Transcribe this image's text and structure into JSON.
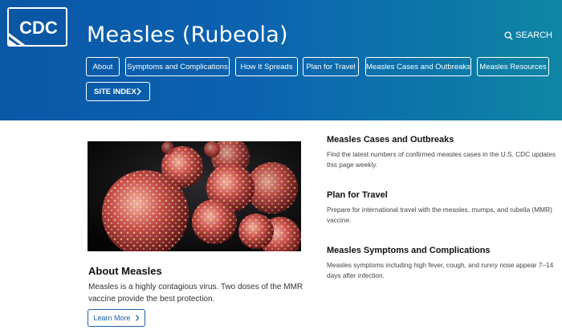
{
  "header": {
    "logo_text": "CDC",
    "title": "Measles (Rubeola)",
    "search_label": "SEARCH",
    "nav": [
      {
        "label": "About"
      },
      {
        "label": "Symptoms and Complications"
      },
      {
        "label": "How It Spreads"
      },
      {
        "label": "Plan for Travel"
      },
      {
        "label": "Measles Cases and Outbreaks"
      },
      {
        "label": "Measles Resources"
      }
    ],
    "site_index_label": "SITE INDEX"
  },
  "about": {
    "image_alt": "Measles virus particles",
    "title": "About Measles",
    "text": "Measles is a highly contagious virus. Two doses of the MMR vaccine provide the best protection.",
    "button_label": "Learn More"
  },
  "cards": [
    {
      "title": "Measles Cases and Outbreaks",
      "text": "Find the latest numbers of confirmed measles cases in the U.S. CDC updates this page weekly."
    },
    {
      "title": "Plan for Travel",
      "text": "Prepare for international travel with the measles, mumps, and rubella (MMR) vaccine."
    },
    {
      "title": "Measles Symptoms and Complications",
      "text": "Measles symptoms including high fever, cough, and runny nose appear 7–14 days after infection."
    }
  ],
  "colors": {
    "header_blue": "#0b63b0",
    "link_blue": "#1b5fa8"
  }
}
